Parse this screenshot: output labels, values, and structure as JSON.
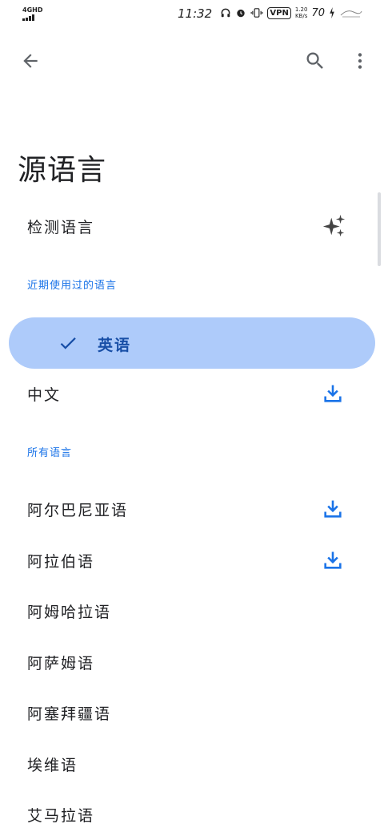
{
  "status_bar": {
    "network": "4GHD",
    "time": "11:32",
    "vpn": "VPN",
    "speed_value": "1.20",
    "speed_unit": "KB/s",
    "battery": "70"
  },
  "toolbar": {
    "back_icon": "arrow-back-icon",
    "search_icon": "search-icon",
    "menu_icon": "more-vert-icon"
  },
  "page": {
    "title": "源语言"
  },
  "detect": {
    "label": "检测语言",
    "icon": "sparkle-icon"
  },
  "recent": {
    "header": "近期使用过的语言",
    "selected": {
      "label": "英语",
      "icon": "check-icon"
    },
    "items": [
      {
        "label": "中文",
        "icon": "download-icon"
      }
    ]
  },
  "all": {
    "header": "所有语言",
    "items": [
      {
        "label": "阿尔巴尼亚语",
        "icon": "download-icon"
      },
      {
        "label": "阿拉伯语",
        "icon": "download-icon"
      },
      {
        "label": "阿姆哈拉语"
      },
      {
        "label": "阿萨姆语"
      },
      {
        "label": "阿塞拜疆语"
      },
      {
        "label": "埃维语"
      },
      {
        "label": "艾马拉语"
      }
    ]
  },
  "colors": {
    "accent": "#1a73e8",
    "selected_bg": "#aecbfa",
    "selected_text": "#174ea6",
    "download_icon": "#1a73e8"
  }
}
